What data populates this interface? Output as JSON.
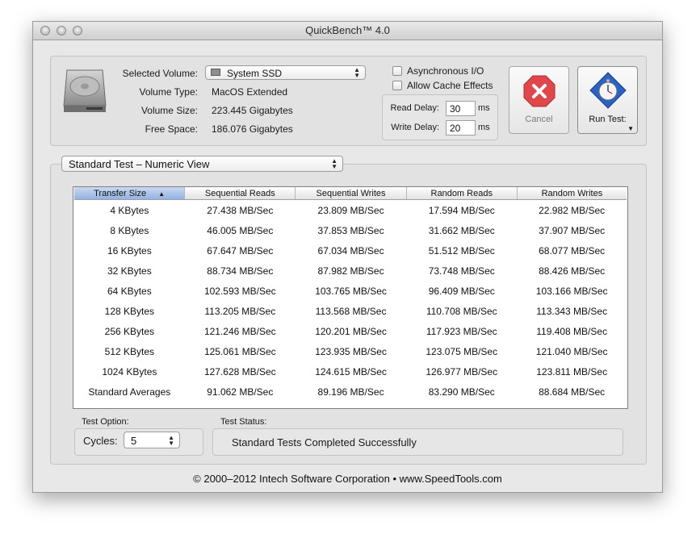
{
  "window": {
    "title": "QuickBench™ 4.0"
  },
  "volume": {
    "selected_label": "Selected Volume:",
    "selected_value": "System SSD",
    "type_label": "Volume Type:",
    "type_value": "MacOS Extended",
    "size_label": "Volume Size:",
    "size_value": "223.445 Gigabytes",
    "free_label": "Free Space:",
    "free_value": "186.076 Gigabytes"
  },
  "options": {
    "async_label": "Asynchronous I/O",
    "async_checked": false,
    "cache_label": "Allow Cache Effects",
    "cache_checked": false,
    "read_delay_label": "Read Delay:",
    "read_delay_value": "30",
    "read_delay_unit": "ms",
    "write_delay_label": "Write Delay:",
    "write_delay_value": "20",
    "write_delay_unit": "ms"
  },
  "buttons": {
    "cancel_label": "Cancel",
    "run_label": "Run Test:"
  },
  "view_select": {
    "value": "Standard Test – Numeric View"
  },
  "table": {
    "columns": [
      "Transfer Size",
      "Sequential Reads",
      "Sequential Writes",
      "Random Reads",
      "Random Writes"
    ],
    "rows": [
      [
        "4 KBytes",
        "27.438 MB/Sec",
        "23.809 MB/Sec",
        "17.594 MB/Sec",
        "22.982 MB/Sec"
      ],
      [
        "8 KBytes",
        "46.005 MB/Sec",
        "37.853 MB/Sec",
        "31.662 MB/Sec",
        "37.907 MB/Sec"
      ],
      [
        "16 KBytes",
        "67.647 MB/Sec",
        "67.034 MB/Sec",
        "51.512 MB/Sec",
        "68.077 MB/Sec"
      ],
      [
        "32 KBytes",
        "88.734 MB/Sec",
        "87.982 MB/Sec",
        "73.748 MB/Sec",
        "88.426 MB/Sec"
      ],
      [
        "64 KBytes",
        "102.593 MB/Sec",
        "103.765 MB/Sec",
        "96.409 MB/Sec",
        "103.166 MB/Sec"
      ],
      [
        "128 KBytes",
        "113.205 MB/Sec",
        "113.568 MB/Sec",
        "110.708 MB/Sec",
        "113.343 MB/Sec"
      ],
      [
        "256 KBytes",
        "121.246 MB/Sec",
        "120.201 MB/Sec",
        "117.923 MB/Sec",
        "119.408 MB/Sec"
      ],
      [
        "512 KBytes",
        "125.061 MB/Sec",
        "123.935 MB/Sec",
        "123.075 MB/Sec",
        "121.040 MB/Sec"
      ],
      [
        "1024 KBytes",
        "127.628 MB/Sec",
        "124.615 MB/Sec",
        "126.977 MB/Sec",
        "123.811 MB/Sec"
      ],
      [
        "Standard Averages",
        "91.062 MB/Sec",
        "89.196 MB/Sec",
        "83.290 MB/Sec",
        "88.684 MB/Sec"
      ]
    ]
  },
  "test_option": {
    "label": "Test Option:",
    "cycles_label": "Cycles:",
    "cycles_value": "5"
  },
  "test_status": {
    "label": "Test Status:",
    "value": "Standard Tests Completed Successfully"
  },
  "footer": {
    "text": "© 2000–2012 Intech Software Corporation • www.SpeedTools.com"
  },
  "colors": {
    "accent_header": "#93b2e3",
    "cancel_red": "#e0464a",
    "stopwatch_blue": "#2a63c8"
  }
}
